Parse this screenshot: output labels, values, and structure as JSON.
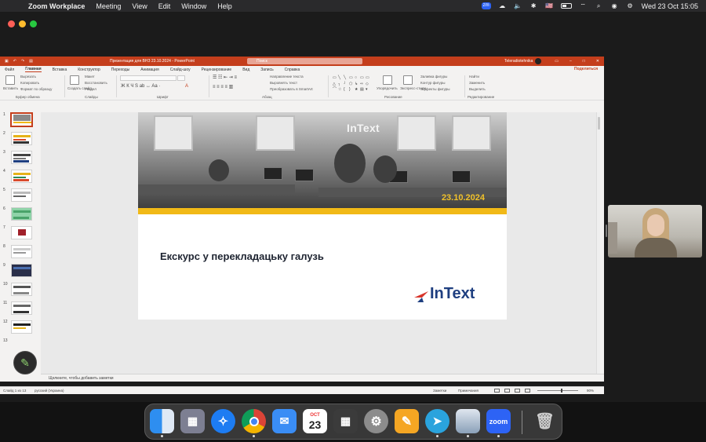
{
  "menubar": {
    "app": "Zoom Workplace",
    "items": [
      "Meeting",
      "View",
      "Edit",
      "Window",
      "Help"
    ],
    "datetime": "Wed 23 Oct  15:05",
    "zoom_badge": "zm"
  },
  "ppt": {
    "doc_title": "Презентация для ВНЗ 23.10.2024  -  PowerPoint",
    "search_placeholder": "Поиск",
    "user": "Teleradiotehnika",
    "tabs": [
      "Файл",
      "Главная",
      "Вставка",
      "Конструктор",
      "Переходы",
      "Анимация",
      "Слайд-шоу",
      "Рецензирование",
      "Вид",
      "Запись",
      "Справка"
    ],
    "share_label": "Поделиться",
    "ribbon": {
      "paste": "Вставить",
      "cut": "Вырезать",
      "copy": "Копировать",
      "format_painter": "Формат по образцу",
      "clipboard_group": "Буфер обмена",
      "new_slide": "Создать слайд",
      "layout": "Макет",
      "reset": "Восстановить",
      "section": "Раздел",
      "slides_group": "Слайды",
      "font_group": "Шрифт",
      "text_direction": "Направление текста",
      "align_text": "Выровнять текст",
      "smartart": "Преобразовать в SmartArt",
      "paragraph_group": "Абзац",
      "arrange": "Упорядочить",
      "quick_styles": "Экспресс-стили",
      "shape_fill": "Заливка фигуры",
      "shape_outline": "Контур фигуры",
      "shape_effects": "Эффекты фигуры",
      "drawing_group": "Рисование",
      "find": "Найти",
      "replace": "Заменить",
      "select": "Выделить",
      "editing_group": "Редактирование"
    },
    "thumbnail_numbers": [
      "1",
      "2",
      "3",
      "4",
      "5",
      "6",
      "7",
      "8",
      "9",
      "10",
      "11",
      "12",
      "13"
    ],
    "slide": {
      "logo_text": "InText",
      "date": "23.10.2024",
      "title": "Екскурс у перекладацьку галузь",
      "brand": "InText"
    },
    "notes_placeholder": "Щелкните, чтобы добавить заметки",
    "status": {
      "slide_count": "Слайд 1 из 13",
      "language": "русский (Украина)",
      "notes": "Заметки",
      "comments": "Примечания",
      "zoom": "90%"
    }
  },
  "dock": {
    "apps": [
      "finder",
      "launchpad",
      "safari",
      "chrome",
      "mail",
      "calendar",
      "calculator",
      "system-settings",
      "pages",
      "telegram",
      "preview",
      "zoom",
      "trash"
    ],
    "calendar_month": "ОСТ",
    "calendar_day": "23",
    "zoom_label": "zoom"
  }
}
